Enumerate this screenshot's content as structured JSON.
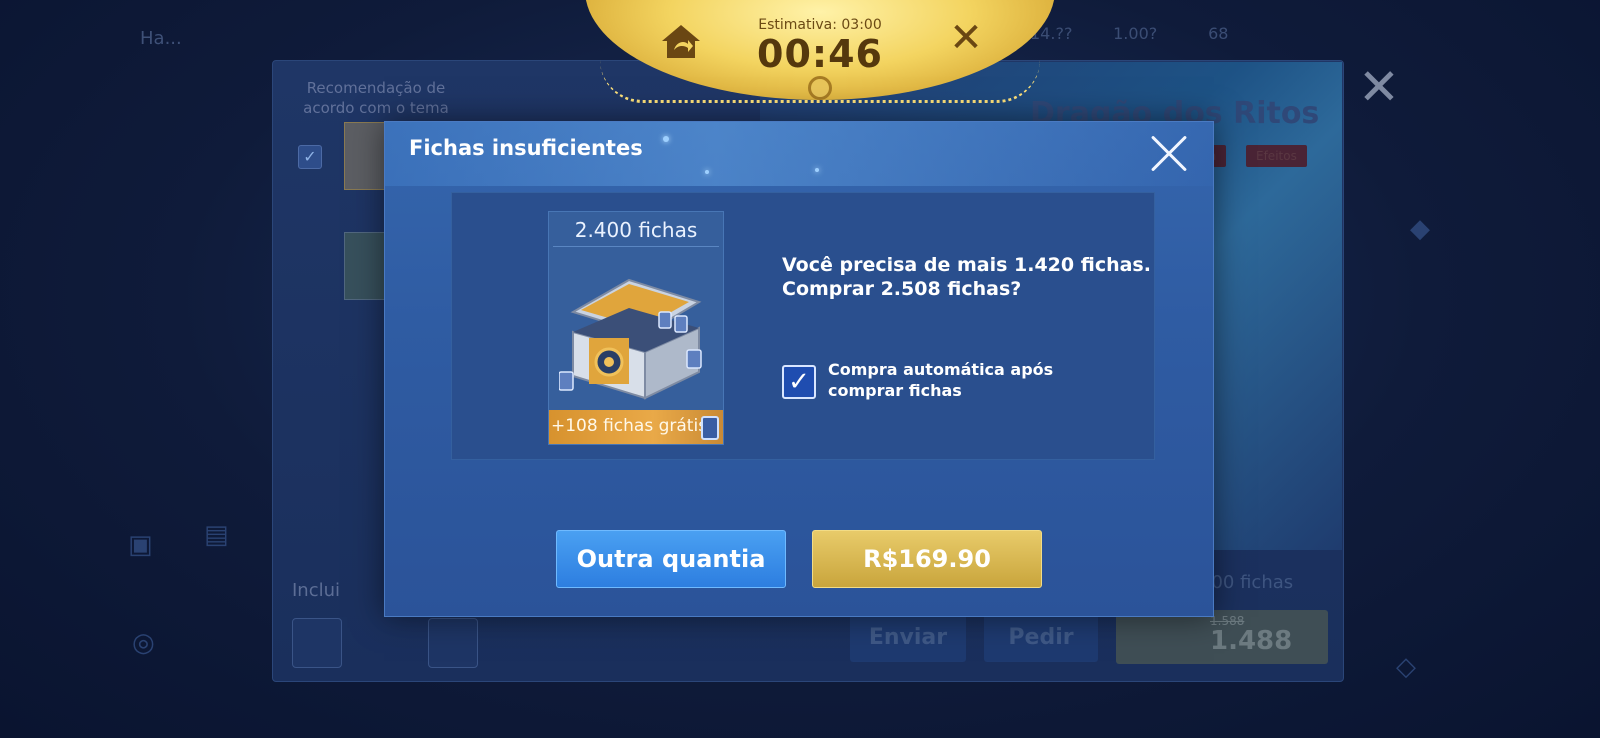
{
  "background": {
    "nav_title": "Ha...",
    "top_right_values": [
      "14.??",
      "1.00?",
      "68"
    ],
    "recommendation": "Recomendação de acordo com o tema",
    "skin_title": "Dragão dos Ritos",
    "tags": [
      "...ncia",
      "Efeitos"
    ],
    "includes_label": "Inclui",
    "total_label": "200 fichas",
    "send_label": "Enviar",
    "ask_label": "Pedir",
    "old_price": "1.588",
    "price": "1.488",
    "close_symbol": "✕"
  },
  "timer": {
    "label": "Estimativa: 03:00",
    "value": "00:46",
    "close_symbol": "✕"
  },
  "modal": {
    "title": "Fichas insuficientes",
    "product": {
      "count": "2.400 fichas",
      "bonus": "+108 fichas grátis"
    },
    "message_line1": "Você precisa de mais 1.420 fichas.",
    "message_line2": "Comprar 2.508 fichas?",
    "auto_purchase_checked": true,
    "auto_purchase_mark": "✓",
    "auto_purchase_label": "Compra automática após comprar fichas",
    "other_amount_label": "Outra quantia",
    "buy_label": "R$169.90"
  },
  "colors": {
    "modal_bg": "#2f5ca3",
    "buy_button": "#d9b74f",
    "other_button": "#3a8ee8",
    "timer_gold": "#f3d460"
  }
}
